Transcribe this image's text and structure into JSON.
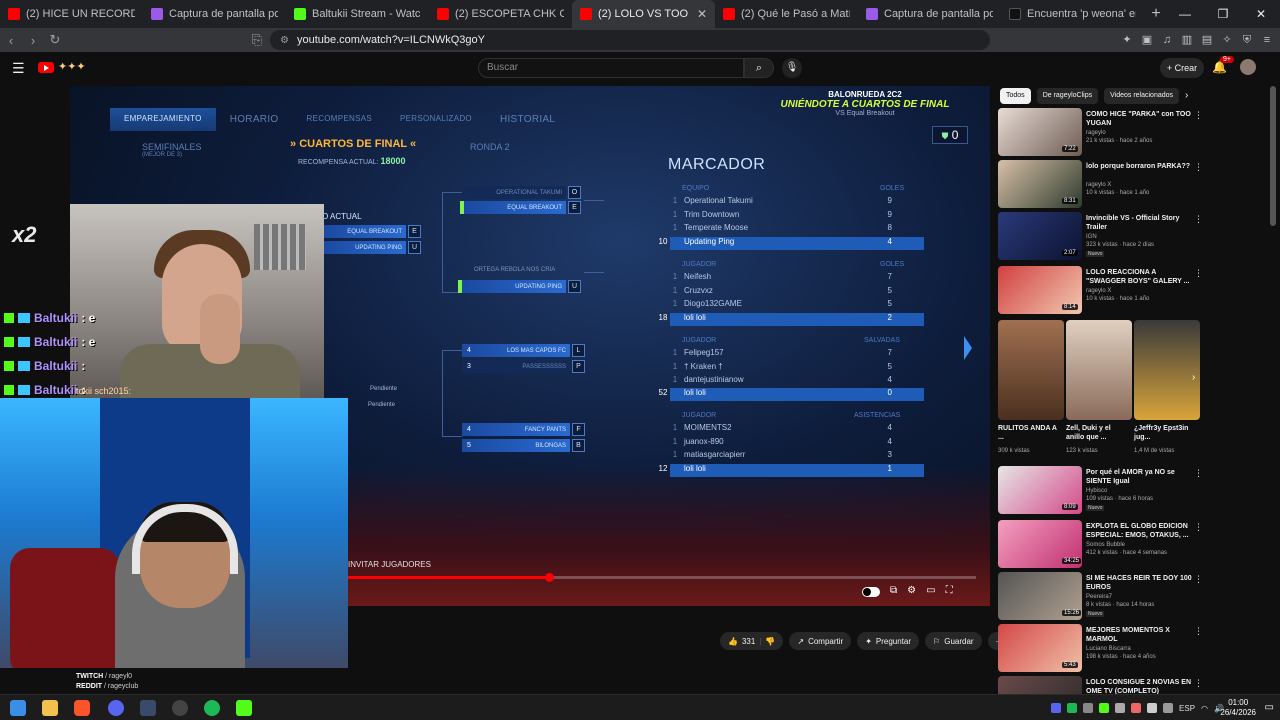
{
  "browser": {
    "tabs": [
      {
        "label": "(2) HICE UN RECORD MUNDIAL",
        "favicon_color": "#ff0000",
        "active": false
      },
      {
        "label": "Captura de pantalla por Lightshot",
        "favicon_color": "#9c5ae8",
        "active": false
      },
      {
        "label": "Baltukii Stream - Watch Live on",
        "favicon_color": "#53fc18",
        "active": false
      },
      {
        "label": "(2) ESCOPETA CHK CHK",
        "favicon_color": "#ff0000",
        "active": false
      },
      {
        "label": "(2) LOLO VS TOO YUGA",
        "favicon_color": "#ff0000",
        "active": true
      },
      {
        "label": "(2) Qué le Pasó a Matías Cand",
        "favicon_color": "#ff0000",
        "active": false
      },
      {
        "label": "Captura de pantalla por Lightshot",
        "favicon_color": "#9c5ae8",
        "active": false
      },
      {
        "label": "Encuentra 'p weona' en TikTok",
        "favicon_color": "#111111",
        "active": false
      }
    ],
    "url": "youtube.com/watch?v=ILCNWkQ3goY"
  },
  "youtube": {
    "search_placeholder": "Buscar",
    "create_label": "Crear",
    "notif_count": "9+",
    "player": {
      "progress": 0.32,
      "invite_text": "INVITAR JUGADORES"
    },
    "actions": {
      "likes": "331",
      "share": "Compartir",
      "ask": "Preguntar",
      "save": "Guardar"
    },
    "chips": [
      "Todos",
      "De rageyloClips",
      "Videos relacionados"
    ],
    "suggested": [
      {
        "title": "COMO HICE \"PARKA\" con TOO YUGAN",
        "channel": "rageylo",
        "meta": "21 k vistas · hace 2 años",
        "duration": "7:22",
        "new": false,
        "thumb": "#c9b9b0"
      },
      {
        "title": "lolo porque borraron PARKA??",
        "channel": "rageylo X",
        "meta": "10 k vistas · hace 1 año",
        "duration": "8:31",
        "new": false,
        "thumb": "#4a5f4a"
      },
      {
        "title": "Invincible VS - Official Story Trailer",
        "channel": "IGN",
        "meta": "323 k vistas · hace 2 días",
        "duration": "2:07",
        "new": true,
        "thumb": "#1e2a55"
      },
      {
        "title": "LOLO REACCIONA A \"SWAGGER BOYS\" GALERY ...",
        "channel": "rageylo X",
        "meta": "10 k vistas · hace 1 año",
        "duration": "8:14",
        "new": false,
        "thumb": "#b43030"
      }
    ],
    "shorts": [
      {
        "title": "RULITOS ANDA A ...",
        "views": "309 k vistas",
        "color": "#8b5a3c"
      },
      {
        "title": "Zell, Duki y el anillo que ...",
        "views": "123 k vistas",
        "color": "#c9a38a"
      },
      {
        "title": "¿Jeffr3y Epst3in jug...",
        "views": "1,4 M de vistas",
        "color": "#d7a540"
      }
    ],
    "suggested2": [
      {
        "title": "Por qué el AMOR ya NO se SIENTE Igual",
        "channel": "Hybisco",
        "meta": "109 vistas · hace 6 horas",
        "duration": "8:09",
        "new": true,
        "thumb": "#d44a8a"
      },
      {
        "title": "EXPLOTA EL GLOBO EDICION ESPECIAL: EMOS, OTAKUS, ...",
        "channel": "Somos Bubble",
        "meta": "412 k vistas · hace 4 semanas",
        "duration": "34:25",
        "new": false,
        "thumb": "#e06aa0"
      },
      {
        "title": "SI ME HACES REIR TE DOY 100 EUROS",
        "channel": "Peereira7",
        "meta": "8 k vistas · hace 14 horas",
        "duration": "15:26",
        "new": true,
        "thumb": "#3a3a4a"
      },
      {
        "title": "MEJORES MOMENTOS X MARMOL",
        "channel": "Luciano Biscarra",
        "meta": "198 k vistas · hace 4 años",
        "duration": "5:43",
        "new": false,
        "thumb": "#d44848"
      },
      {
        "title": "LOLO CONSIGUE 2 NOVIAS EN OME TV (COMPLETO)",
        "channel": "",
        "meta": "",
        "duration": "",
        "new": false,
        "thumb": "#6a4a4a"
      }
    ]
  },
  "game": {
    "tabs": [
      "EMPAREJAMIENTO",
      "HORARIO",
      "RECOMPENSAS",
      "PERSONALIZADO",
      "HISTORIAL"
    ],
    "banner_line1": "BALONRUEDA 2C2",
    "banner_line2": "UNIÉNDOTE A CUARTOS DE FINAL",
    "banner_line3": "VS Equal Breakout",
    "badge_value": "0",
    "semis": "SEMIFINALES",
    "semis_sub": "(MEJOR DE 3)",
    "quarters": "CUARTOS DE FINAL",
    "reward_label": "RECOMPENSA ACTUAL:",
    "reward_value": "18000",
    "round2": "RONDA 2",
    "current_label": "IDO ACTUAL",
    "bracket": {
      "current_a": "EQUAL BREAKOUT",
      "current_a_seed": "E",
      "current_b": "UPDATING PING",
      "current_b_seed": "U",
      "r2_top_a": "OPERATIONAL TAKUMI",
      "r2_top_a_seed": "O",
      "r2_top_b": "EQUAL BREAKOUT",
      "r2_top_b_seed": "E",
      "r2_mid_label": "ORTEGA REBOLA NOS CRIA",
      "r2_mid_b": "UPDATING PING",
      "r2_mid_b_seed": "U",
      "m3_a": "LOS MAS CAPOS FC",
      "m3_a_num": "4",
      "m3_a_seed": "L",
      "m3_b": "PASSESSSSSS",
      "m3_b_num": "3",
      "m3_b_seed": "P",
      "m4_a": "FANCY PANTS",
      "m4_a_num": "4",
      "m4_a_seed": "F",
      "m4_b": "BILONGAS",
      "m4_b_num": "5",
      "m4_b_seed": "B",
      "pending": "Pendiente"
    },
    "scoreboard": {
      "title": "MARCADOR",
      "sections": [
        {
          "head": "EQUIPO",
          "stat": "GOLES",
          "rows": [
            {
              "rank": "1",
              "name": "Operational Takumi",
              "value": "9"
            },
            {
              "rank": "1",
              "name": "Trim Downtown",
              "value": "9"
            },
            {
              "rank": "1",
              "name": "Temperate Moose",
              "value": "8"
            }
          ],
          "me": {
            "rank": "10",
            "name": "Updating Ping",
            "value": "4"
          }
        },
        {
          "head": "JUGADOR",
          "stat": "GOLES",
          "rows": [
            {
              "rank": "1",
              "name": "Neifesh",
              "value": "7"
            },
            {
              "rank": "1",
              "name": "Cruzvxz",
              "value": "5"
            },
            {
              "rank": "1",
              "name": "Diogo132GAME",
              "value": "5"
            }
          ],
          "me": {
            "rank": "18",
            "name": "loli loli",
            "value": "2"
          }
        },
        {
          "head": "JUGADOR",
          "stat": "SALVADAS",
          "rows": [
            {
              "rank": "1",
              "name": "Felipeg157",
              "value": "7"
            },
            {
              "rank": "1",
              "name": "† Kraken †",
              "value": "5"
            },
            {
              "rank": "1",
              "name": "dantejustinianow",
              "value": "4"
            }
          ],
          "me": {
            "rank": "52",
            "name": "loli loli",
            "value": "0"
          }
        },
        {
          "head": "JUGADOR",
          "stat": "ASISTENCIAS",
          "rows": [
            {
              "rank": "1",
              "name": "MOIMENTS2",
              "value": "4"
            },
            {
              "rank": "1",
              "name": "juanox-890",
              "value": "4"
            },
            {
              "rank": "1",
              "name": "matiasgarciapierr",
              "value": "3"
            }
          ],
          "me": {
            "rank": "12",
            "name": "loli loli",
            "value": "1"
          }
        }
      ]
    }
  },
  "overlay": {
    "chat": [
      {
        "nick": "Baltukii",
        "msg": ": e"
      },
      {
        "nick": "Baltukii",
        "msg": ": e"
      },
      {
        "nick": "Baltukii",
        "msg": ":"
      },
      {
        "nick": "Baltukii",
        "msg": ":"
      }
    ],
    "combo": "x2",
    "chat_mini": "tokii   sch2015:",
    "social_twitch_label": "TWITCH",
    "social_twitch": "/ rageyl0",
    "social_reddit_label": "REDDIT",
    "social_reddit": "/ rageyclub"
  },
  "taskbar": {
    "lang": "ESP",
    "time": "01:00",
    "date": "26/4/2026"
  }
}
